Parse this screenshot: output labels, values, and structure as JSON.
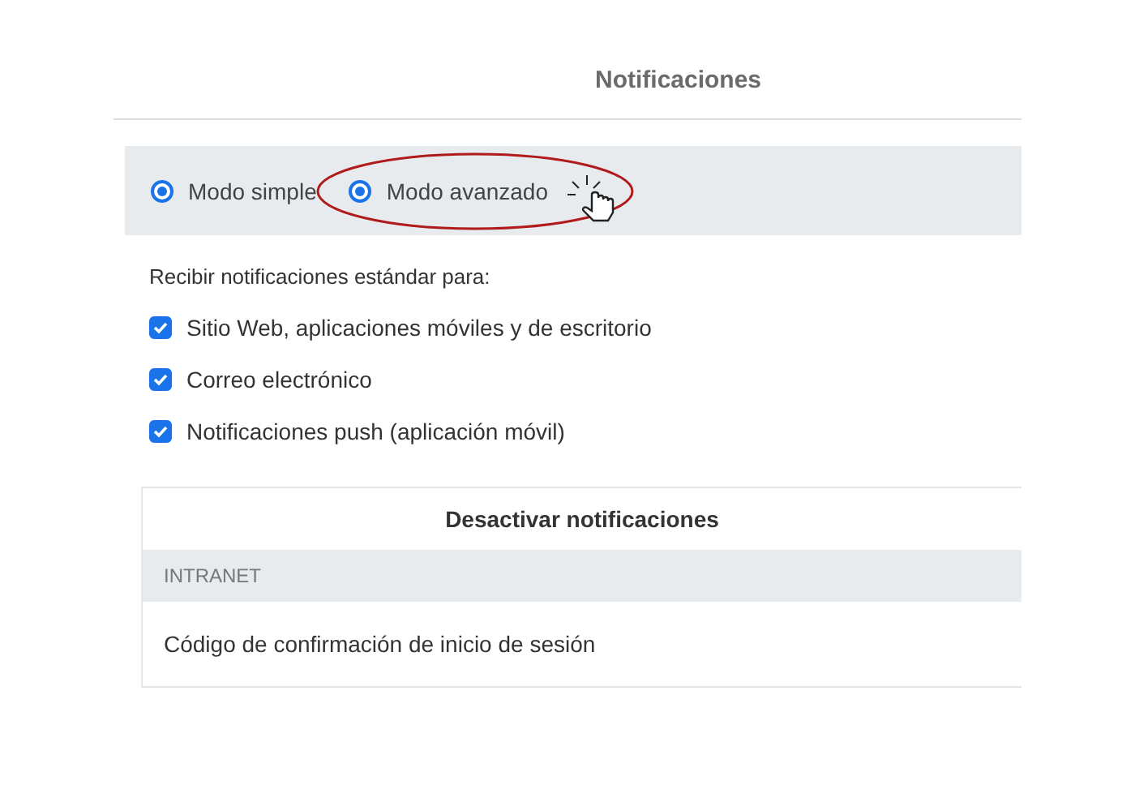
{
  "header": {
    "title": "Notificaciones"
  },
  "modes": [
    {
      "label": "Modo simple",
      "selected": true,
      "highlighted": false
    },
    {
      "label": "Modo avanzado",
      "selected": true,
      "highlighted": true
    }
  ],
  "standard": {
    "intro": "Recibir notificaciones estándar para:",
    "options": [
      {
        "label": "Sitio Web, aplicaciones móviles y de escritorio",
        "checked": true
      },
      {
        "label": "Correo electrónico",
        "checked": true
      },
      {
        "label": "Notificaciones push (aplicación móvil)",
        "checked": true
      }
    ]
  },
  "table": {
    "heading": "Desactivar notificaciones",
    "section": "INTRANET",
    "rows": [
      "Código de confirmación de inicio de sesión"
    ]
  }
}
